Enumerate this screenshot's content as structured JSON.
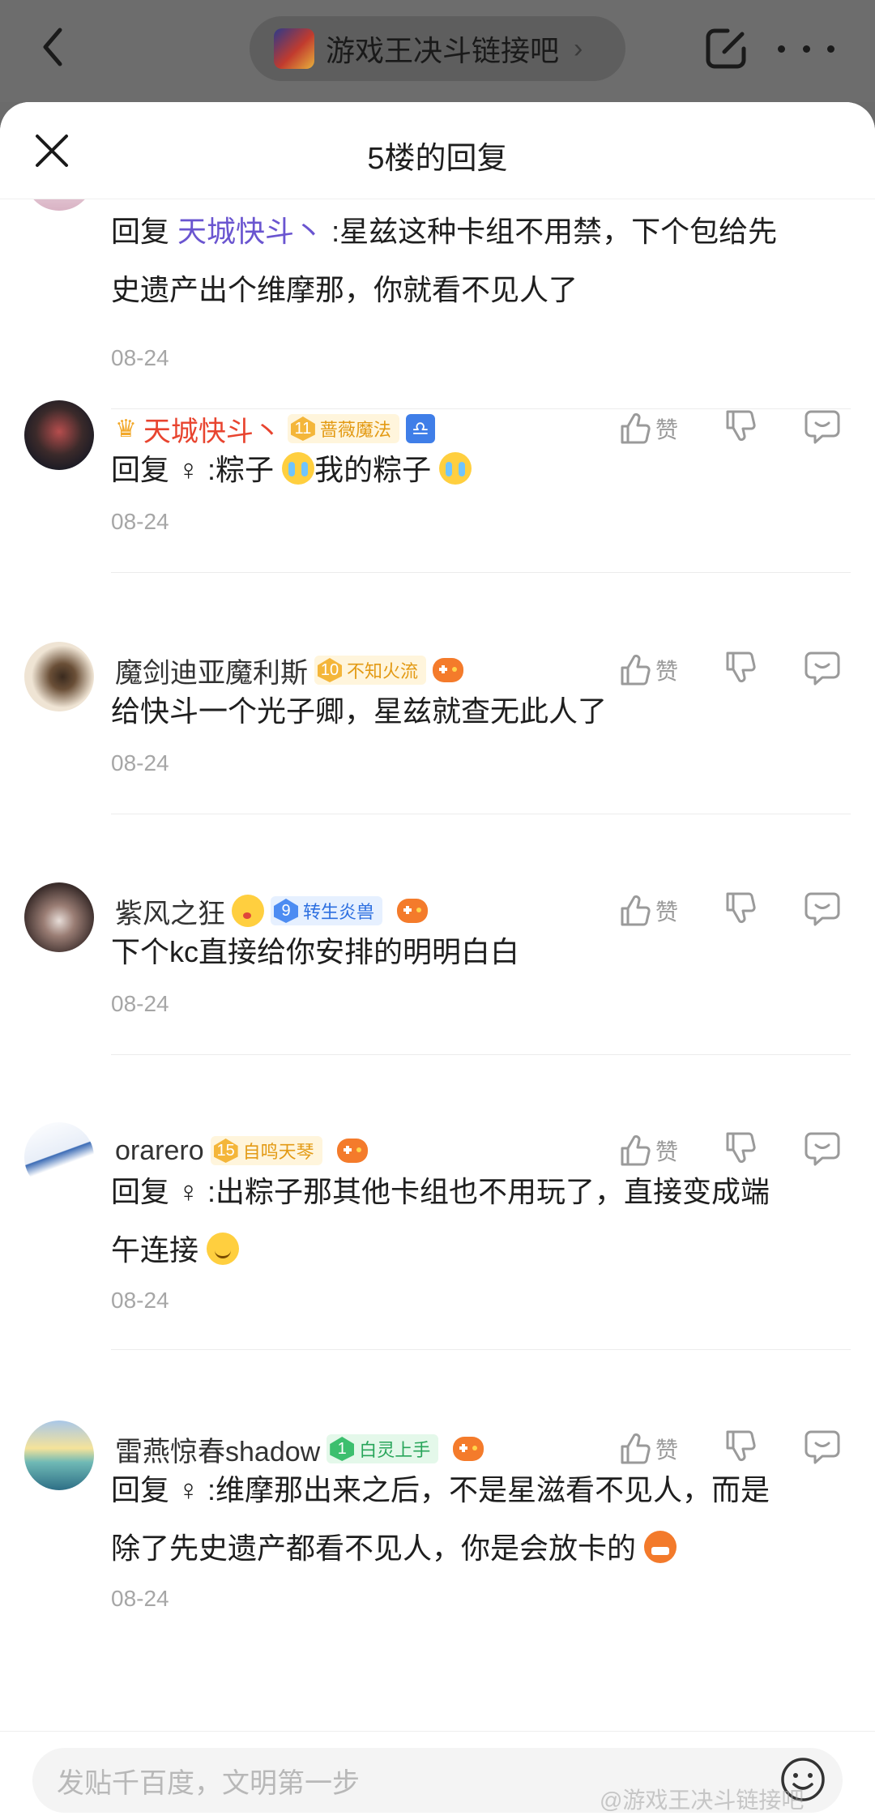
{
  "topbar": {
    "forum_name": "游戏王决斗链接吧",
    "chevron": "›"
  },
  "sheet": {
    "title": "5楼的回复",
    "reply_prefix": "回复",
    "like_label": "赞"
  },
  "first_reply": {
    "mention": "天城快斗丶",
    "text": ":星兹这种卡组不用禁，下个包给先史遗产出个维摩那，你就看不见人了",
    "line1": ":星兹这种卡组不用禁，下个包给先",
    "line2": "史遗产出个维摩那，你就看不见人了",
    "date": "08-24"
  },
  "replies": [
    {
      "username": "天城快斗丶",
      "username_color": "#e8442f",
      "has_crown": true,
      "badge_level": "11",
      "badge_name": "蔷薇魔法",
      "badge_color": "gold",
      "extra_icon": "libra-zodiac-icon",
      "mention": "♀",
      "text_parts": [
        ":粽子 ",
        "我的粽子 "
      ],
      "date": "08-24"
    },
    {
      "username": "魔剑迪亚魔利斯",
      "badge_level": "10",
      "badge_name": "不知火流",
      "badge_color": "gold",
      "extra_icon": "gamepad-icon",
      "text": "给快斗一个光子卿，星兹就查无此人了",
      "date": "08-24"
    },
    {
      "username": "紫风之狂",
      "badge_level": "9",
      "badge_name": "转生炎兽",
      "badge_color": "blue",
      "extra_icon": "gamepad-icon",
      "text": "下个kc直接给你安排的明明白白",
      "date": "08-24"
    },
    {
      "username": "orarero",
      "badge_level": "15",
      "badge_name": "自鸣天琴",
      "badge_color": "gold",
      "extra_icon": "gamepad-icon",
      "mention": "♀",
      "line1": ":出粽子那其他卡组也不用玩了，直接变成端",
      "line2": "午连接 ",
      "date": "08-24"
    },
    {
      "username": "雷燕惊春shadow",
      "badge_level": "1",
      "badge_name": "白灵上手",
      "badge_color": "green",
      "extra_icon": "gamepad-icon",
      "mention": "♀",
      "line1": ":维摩那出来之后，不是星滋看不见人，而是",
      "line2": "除了先史遗产都看不见人，你是会放卡的 ",
      "date": "08-24"
    }
  ],
  "bottom": {
    "input_placeholder": "发贴千百度，文明第一步"
  },
  "watermark": "@游戏王决斗链接吧"
}
